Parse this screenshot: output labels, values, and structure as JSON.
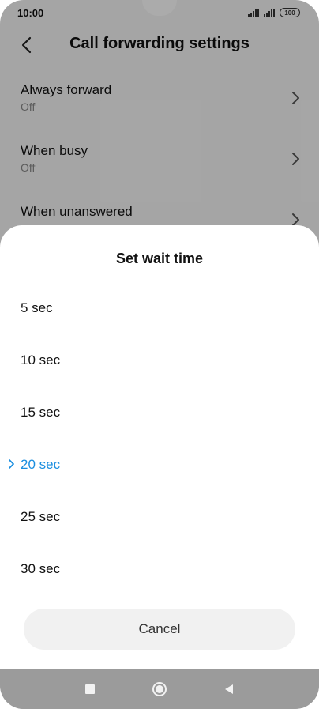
{
  "status_bar": {
    "time": "10:00",
    "battery": "100"
  },
  "header": {
    "title": "Call forwarding settings"
  },
  "settings": [
    {
      "title": "Always forward",
      "subtitle": "Off"
    },
    {
      "title": "When busy",
      "subtitle": "Off"
    },
    {
      "title": "When unanswered",
      "subtitle": ""
    }
  ],
  "sheet": {
    "title": "Set wait time",
    "options": [
      "5 sec",
      "10 sec",
      "15 sec",
      "20 sec",
      "25 sec",
      "30 sec"
    ],
    "selected": "20 sec",
    "cancel_label": "Cancel"
  },
  "colors": {
    "accent": "#1a8ee0",
    "dim_overlay": "rgba(0,0,0,0.33)"
  },
  "icons": {
    "back": "back-arrow-icon",
    "chevron": "chevron-right-icon",
    "check": "check-chevron-icon",
    "nav_recents": "square-icon",
    "nav_home": "circle-icon",
    "nav_back": "triangle-back-icon"
  }
}
